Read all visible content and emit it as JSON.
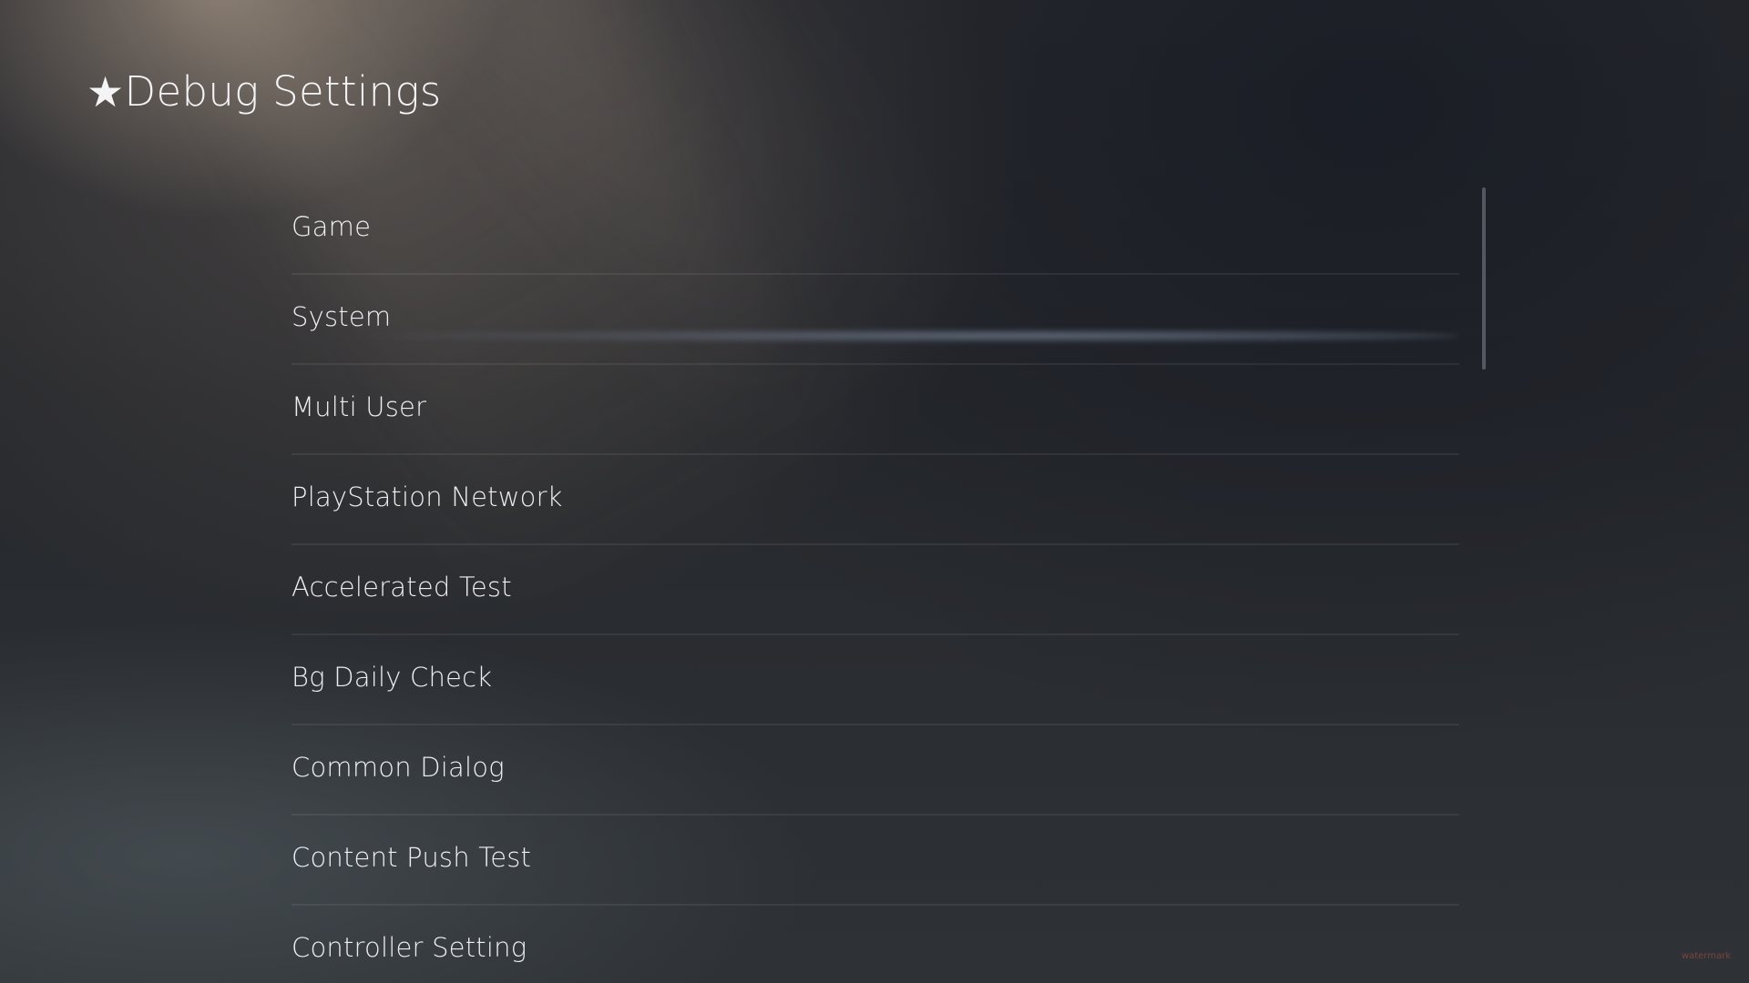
{
  "header": {
    "star_icon": "★",
    "title": "Debug Settings"
  },
  "menu": {
    "items": [
      {
        "label": "Game"
      },
      {
        "label": "System",
        "focused": true
      },
      {
        "label": "Multi User"
      },
      {
        "label": "PlayStation Network"
      },
      {
        "label": "Accelerated Test"
      },
      {
        "label": "Bg Daily Check"
      },
      {
        "label": "Common Dialog"
      },
      {
        "label": "Content Push Test"
      },
      {
        "label": "Controller Setting"
      }
    ]
  },
  "colors": {
    "text": "#eceef2",
    "background": "#26282c",
    "divider": "#3a3c40",
    "focus_glow": "#a0afc8"
  },
  "watermark": "watermark"
}
